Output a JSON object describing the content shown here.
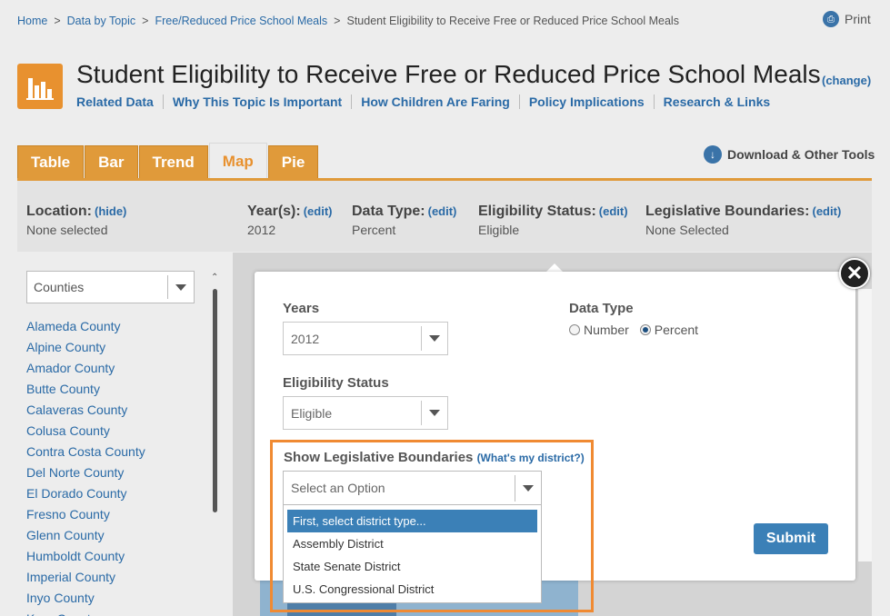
{
  "breadcrumb": {
    "items": [
      "Home",
      "Data by Topic",
      "Free/Reduced Price School Meals",
      "Student Eligibility to Receive Free or Reduced Price School Meals"
    ],
    "separator": ">"
  },
  "print_label": "Print",
  "title": "Student Eligibility to Receive Free or Reduced Price School Meals",
  "change_link": "(change)",
  "subnav": [
    "Related Data",
    "Why This Topic Is Important",
    "How Children Are Faring",
    "Policy Implications",
    "Research & Links"
  ],
  "tabs": [
    {
      "label": "Table",
      "active": false
    },
    {
      "label": "Bar",
      "active": false
    },
    {
      "label": "Trend",
      "active": false
    },
    {
      "label": "Map",
      "active": true
    },
    {
      "label": "Pie",
      "active": false
    }
  ],
  "download_label": "Download & Other Tools",
  "filters": {
    "location": {
      "label": "Location:",
      "link": "(hide)",
      "value": "None selected"
    },
    "years": {
      "label": "Year(s):",
      "link": "(edit)",
      "value": "2012"
    },
    "data_type": {
      "label": "Data Type:",
      "link": "(edit)",
      "value": "Percent"
    },
    "eligibility": {
      "label": "Eligibility Status:",
      "link": "(edit)",
      "value": "Eligible"
    },
    "legislative": {
      "label": "Legislative Boundaries:",
      "link": "(edit)",
      "value": "None Selected"
    }
  },
  "left_panel": {
    "region_select": "Counties",
    "counties": [
      "Alameda County",
      "Alpine County",
      "Amador County",
      "Butte County",
      "Calaveras County",
      "Colusa County",
      "Contra Costa County",
      "Del Norte County",
      "El Dorado County",
      "Fresno County",
      "Glenn County",
      "Humboldt County",
      "Imperial County",
      "Inyo County",
      "Kern County"
    ]
  },
  "modal": {
    "years_label": "Years",
    "years_value": "2012",
    "eligibility_label": "Eligibility Status",
    "eligibility_value": "Eligible",
    "data_type_label": "Data Type",
    "data_type_options": [
      {
        "label": "Number",
        "selected": false
      },
      {
        "label": "Percent",
        "selected": true
      }
    ],
    "boundaries_label": "Show Legislative Boundaries",
    "whats_my_district": "(What's my district?)",
    "boundaries_placeholder": "Select an Option",
    "boundaries_options": [
      "First, select district type...",
      "Assembly District",
      "State Senate District",
      "U.S. Congressional District"
    ],
    "submit_label": "Submit",
    "close_symbol": "✕"
  },
  "colors": {
    "accent_orange": "#e8912f",
    "link_blue": "#2a6aa6",
    "button_blue": "#3b80b7",
    "highlight_border": "#f08a32"
  }
}
